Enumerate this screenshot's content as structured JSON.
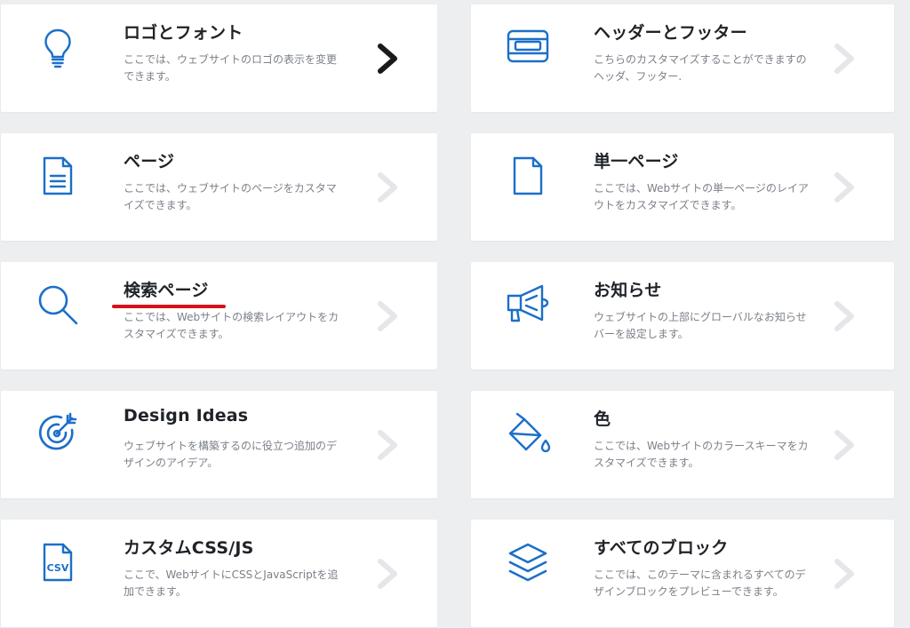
{
  "accent_color": "#1b6fc9",
  "active_chevron_color": "#1a1a1a",
  "inactive_chevron_color": "#e4e6e9",
  "highlight_underline_color": "#d6111a",
  "cards": [
    {
      "title": "ロゴとフォント",
      "desc": "ここでは、ウェブサイトのロゴの表示を変更できます。",
      "icon": "lightbulb-icon",
      "active": true
    },
    {
      "title": "ヘッダーとフッター",
      "desc": "こちらのカスタマイズすることができますのヘッダ、フッター.",
      "icon": "header-footer-icon",
      "active": false
    },
    {
      "title": "ページ",
      "desc": "ここでは、ウェブサイトのページをカスタマイズできます。",
      "icon": "document-icon",
      "active": false
    },
    {
      "title": "単一ページ",
      "desc": "ここでは、Webサイトの単一ページのレイアウトをカスタマイズできます。",
      "icon": "blank-page-icon",
      "active": false
    },
    {
      "title": "検索ページ",
      "desc": "ここでは、Webサイトの検索レイアウトをカスタマイズできます。",
      "icon": "search-icon",
      "active": false
    },
    {
      "title": "お知らせ",
      "desc": "ウェブサイトの上部にグローバルなお知らせバーを設定します。",
      "icon": "megaphone-icon",
      "active": false
    },
    {
      "title": "Design Ideas",
      "desc": "ウェブサイトを構築するのに役立つ追加のデザインのアイデア。",
      "icon": "target-icon",
      "active": false
    },
    {
      "title": "色",
      "desc": "ここでは、Webサイトのカラースキーマをカスタマイズできます。",
      "icon": "paint-bucket-icon",
      "active": false
    },
    {
      "title": "カスタムCSS/JS",
      "desc": "ここで、WebサイトにCSSとJavaScriptを追加できます。",
      "icon": "csv-file-icon",
      "active": false
    },
    {
      "title": "すべてのブロック",
      "desc": "ここでは、このテーマに含まれるすべてのデザインブロックをプレビューできます。",
      "icon": "layers-icon",
      "active": false
    }
  ]
}
